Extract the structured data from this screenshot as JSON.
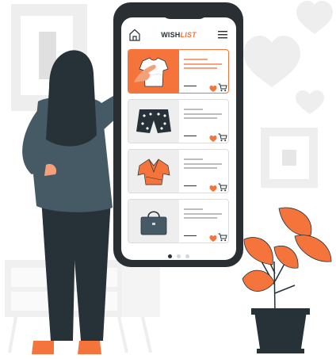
{
  "app": {
    "brand_main": "WISH",
    "brand_accent": "LIST"
  },
  "icons": {
    "home": "home-icon",
    "menu": "hamburger-menu-icon",
    "favorite": "heart-icon",
    "cart": "shopping-cart-icon"
  },
  "wishlist": {
    "items": [
      {
        "product": "t-shirt",
        "highlighted": true
      },
      {
        "product": "shorts",
        "highlighted": false
      },
      {
        "product": "blouse",
        "highlighted": false
      },
      {
        "product": "handbag",
        "highlighted": false
      }
    ]
  },
  "pagination": {
    "total": 3,
    "current": 1
  },
  "colors": {
    "accent": "#f4743b",
    "dark": "#263238",
    "phone_frame": "#2a2f33",
    "background_shapes": "#eeeeee"
  }
}
